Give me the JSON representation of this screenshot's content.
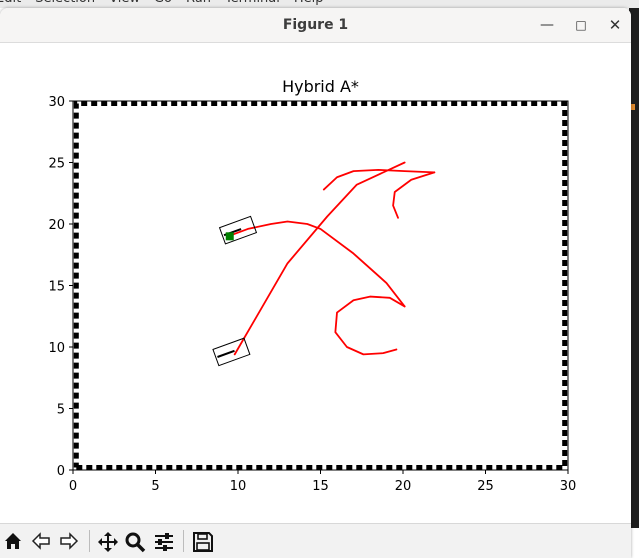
{
  "window": {
    "title": "Figure 1"
  },
  "background_menu": [
    "Edit",
    "Selection",
    "View",
    "Go",
    "Run",
    "Terminal",
    "Help"
  ],
  "icons": {
    "minimize": "minimize-icon",
    "maximize": "maximize-icon",
    "close": "close-icon"
  },
  "toolbar": [
    {
      "name": "home-button",
      "icon": "home-icon",
      "glyph": "⌂"
    },
    {
      "name": "back-button",
      "icon": "back-arrow-icon",
      "glyph": "⇦"
    },
    {
      "name": "forward-button",
      "icon": "forward-arrow-icon",
      "glyph": "⇨"
    },
    {
      "name": "pan-button",
      "icon": "move-icon",
      "glyph": "✥"
    },
    {
      "name": "zoom-button",
      "icon": "magnifier-icon",
      "glyph": "🔍"
    },
    {
      "name": "configure-subplots-button",
      "icon": "sliders-icon",
      "glyph": "☰"
    },
    {
      "name": "save-button",
      "icon": "floppy-disk-icon",
      "glyph": "💾"
    }
  ],
  "chart_data": {
    "type": "line",
    "title": "Hybrid A*",
    "xlabel": "",
    "ylabel": "",
    "xlim": [
      0,
      30
    ],
    "ylim": [
      0,
      30
    ],
    "xticks": [
      0,
      5,
      10,
      15,
      20,
      25,
      30
    ],
    "yticks": [
      0,
      5,
      10,
      15,
      20,
      25,
      30
    ],
    "grid": false,
    "colors": {
      "path": "#ff0000",
      "boundary": "#000000",
      "vehicle": "#000000",
      "marker": "#008000"
    },
    "boundary": {
      "style": "dashed",
      "x": [
        0.2,
        29.8,
        29.8,
        0.2,
        0.2
      ],
      "y": [
        0.2,
        0.2,
        29.8,
        29.8,
        0.2
      ]
    },
    "series": [
      {
        "x": [
          9.8,
          13.0,
          15.4,
          17.2,
          20.1
        ],
        "y": [
          9.4,
          16.8,
          20.6,
          23.2,
          25.0
        ],
        "color": "#ff0000"
      },
      {
        "x": [
          9.6,
          10.6,
          12.0,
          13.0,
          14.2,
          15.0,
          17.0,
          19.0,
          20.1
        ],
        "y": [
          19.1,
          19.6,
          20.0,
          20.2,
          20.0,
          19.6,
          17.6,
          15.2,
          13.3
        ],
        "color": "#ff0000"
      },
      {
        "x": [
          15.2,
          16.0,
          17.0,
          18.5,
          20.1,
          21.9
        ],
        "y": [
          22.8,
          23.8,
          24.3,
          24.4,
          24.3,
          24.2
        ],
        "color": "#ff0000"
      },
      {
        "x": [
          21.9,
          20.5,
          19.5,
          19.4,
          19.7
        ],
        "y": [
          24.2,
          23.6,
          22.6,
          21.5,
          20.5
        ],
        "color": "#ff0000"
      },
      {
        "x": [
          20.1,
          19.2,
          18.0,
          17.0,
          16.0,
          15.9,
          16.6,
          17.6,
          18.8,
          19.6
        ],
        "y": [
          13.3,
          14.0,
          14.1,
          13.8,
          12.8,
          11.2,
          10.0,
          9.4,
          9.5,
          9.8
        ],
        "color": "#ff0000"
      }
    ],
    "vehicles": [
      {
        "x": 10.0,
        "y": 19.5,
        "angle_deg": 20
      },
      {
        "x": 9.6,
        "y": 9.6,
        "angle_deg": 20
      }
    ],
    "marker": {
      "x": 9.5,
      "y": 19.0
    }
  }
}
